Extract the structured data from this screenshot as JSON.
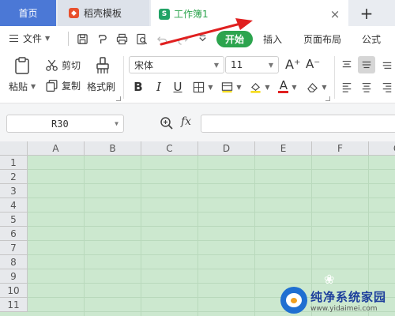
{
  "tabs": {
    "home": "首页",
    "templates": "稻壳模板",
    "workbook": "工作簿1",
    "workbook_icon_letter": "S",
    "close_symbol": "×",
    "add_symbol": "+"
  },
  "menu": {
    "file": "文件",
    "items": [
      "开始",
      "插入",
      "页面布局",
      "公式"
    ],
    "active": "开始",
    "active_color": "#2ca44e"
  },
  "quick_access_icons": [
    "save-icon",
    "format-painter-icon",
    "print-icon",
    "print-preview-icon",
    "undo-icon",
    "redo-icon",
    "more-icon"
  ],
  "ribbon": {
    "paste": "粘贴",
    "cut": "剪切",
    "copy": "复制",
    "format_painter": "格式刷",
    "font_name": "宋体",
    "font_size": "11",
    "bold": "B",
    "italic": "I",
    "underline": "U",
    "font_color_letter": "A",
    "grow_font": "A⁺",
    "shrink_font": "A⁻"
  },
  "formula_bar": {
    "cell_ref": "R30",
    "fx_label": "fx",
    "formula": ""
  },
  "sheet": {
    "columns": [
      "A",
      "B",
      "C",
      "D",
      "E",
      "F",
      "G"
    ],
    "rows": [
      "1",
      "2",
      "3",
      "4",
      "5",
      "6",
      "7",
      "8",
      "9",
      "10",
      "11"
    ],
    "grid_color": "#cce8cf"
  },
  "watermark": {
    "title": "纯净系统家园",
    "url": "www.yidaimei.com"
  },
  "colors": {
    "home_tab": "#4b78d6",
    "arrow": "#e02020",
    "font_color_bar": "#e02020",
    "fill_color_bar": "#f5d800"
  }
}
